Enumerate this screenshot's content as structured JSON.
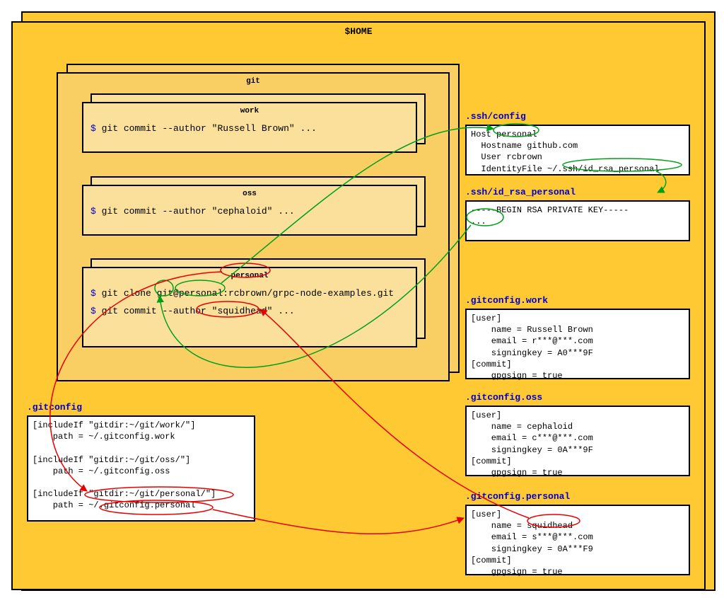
{
  "home": {
    "title": "$HOME"
  },
  "git": {
    "title": "git"
  },
  "work": {
    "title": "work",
    "prompt": "$",
    "cmd": "git commit --author \"Russell Brown\" ..."
  },
  "oss": {
    "title": "oss",
    "prompt": "$",
    "cmd": "git commit --author \"cephaloid\" ..."
  },
  "personal": {
    "title": "personal",
    "prompt1": "$",
    "cmd1": "git clone git@personal:rcbrown/grpc-node-examples.git",
    "prompt2": "$",
    "cmd2": "git commit --author \"squidhead\" ..."
  },
  "ssh_config": {
    "label": ".ssh/config",
    "content": "Host personal\n  Hostname github.com\n  User rcbrown\n  IdentityFile ~/.ssh/id_rsa_personal"
  },
  "ssh_key": {
    "label": ".ssh/id_rsa_personal",
    "content": "-----BEGIN RSA PRIVATE KEY-----\n..."
  },
  "gitconfig_work": {
    "label": ".gitconfig.work",
    "content": "[user]\n    name = Russell Brown\n    email = r***@***.com\n    signingkey = A0***9F\n[commit]\n    gpgsign = true"
  },
  "gitconfig_oss": {
    "label": ".gitconfig.oss",
    "content": "[user]\n    name = cephaloid\n    email = c***@***.com\n    signingkey = 0A***9F\n[commit]\n    gpgsign = true"
  },
  "gitconfig_personal": {
    "label": ".gitconfig.personal",
    "content": "[user]\n    name = squidhead\n    email = s***@***.com\n    signingkey = 0A***F9\n[commit]\n    gpgsign = true"
  },
  "gitconfig": {
    "label": ".gitconfig",
    "content": "[includeIf \"gitdir:~/git/work/\"]\n    path = ~/.gitconfig.work\n\n[includeIf \"gitdir:~/git/oss/\"]\n    path = ~/.gitconfig.oss\n\n[includeIf \"gitdir:~/git/personal/\"]\n    path = ~/.gitconfig.personal"
  }
}
